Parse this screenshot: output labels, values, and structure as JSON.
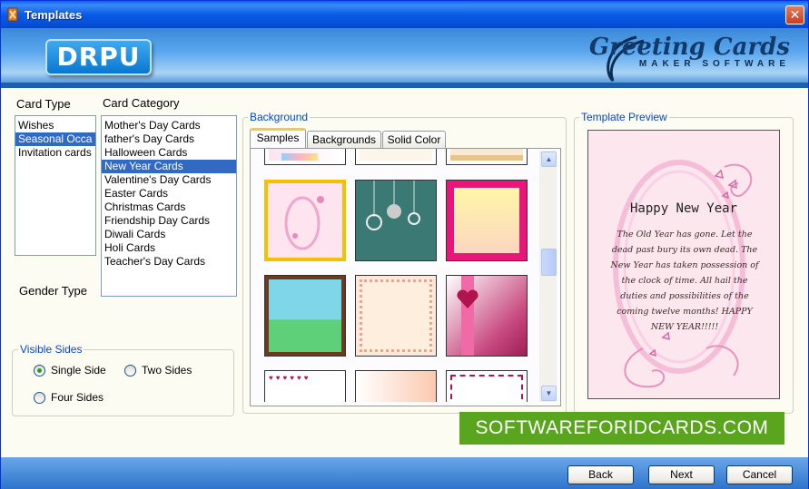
{
  "window": {
    "title": "Templates"
  },
  "banner": {
    "logo": "DRPU",
    "brand_title": "Greeting Cards",
    "brand_subtitle": "MAKER SOFTWARE"
  },
  "card_type": {
    "label": "Card Type",
    "items": [
      "Wishes",
      "Seasonal Occa",
      "Invitation cards"
    ],
    "selected_index": 1
  },
  "card_category": {
    "label": "Card Category",
    "items": [
      "Mother's Day Cards",
      "father's Day Cards",
      "Halloween Cards",
      "New Year Cards",
      "Valentine's Day Cards",
      "Easter Cards",
      "Christmas Cards",
      "Friendship Day Cards",
      "Diwali Cards",
      "Holi Cards",
      "Teacher's Day Cards"
    ],
    "selected_index": 3
  },
  "gender_type": {
    "label": "Gender Type"
  },
  "visible_sides": {
    "label": "Visible Sides",
    "options": [
      "Single Side",
      "Two Sides",
      "Four Sides"
    ],
    "selected": "Single Side"
  },
  "background": {
    "label": "Background",
    "tabs": [
      "Samples",
      "Backgrounds",
      "Solid Color"
    ],
    "active_tab": "Samples"
  },
  "preview": {
    "label": "Template Preview",
    "heading": "Happy New Year",
    "body": "The Old Year has gone. Let the dead past bury its own dead. The New Year has taken possession of the clock of time. All hail the duties and possibilities of the coming twelve months! HAPPY NEW YEAR!!!!!"
  },
  "watermark": "SOFTWAREFORIDCARDS.COM",
  "buttons": {
    "back": "Back",
    "next": "Next",
    "cancel": "Cancel"
  },
  "colors": {
    "selection": "#316ac5",
    "group_title": "#0046d5",
    "watermark_bg": "#5aa51e",
    "selected_thumb": "#f2c200"
  }
}
